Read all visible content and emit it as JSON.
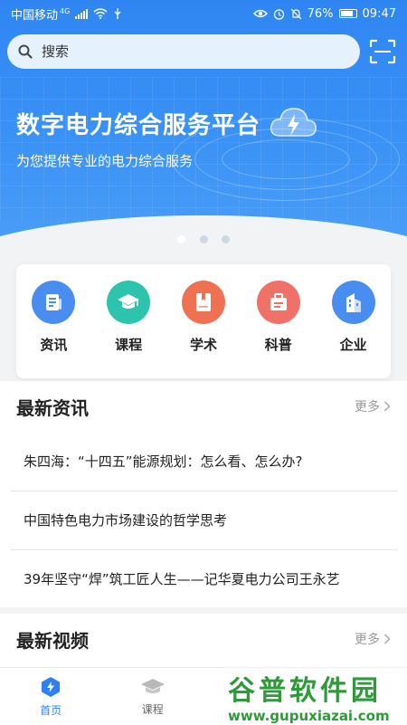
{
  "status_bar": {
    "carrier": "中国移动",
    "network": "4G",
    "battery": "76%",
    "time": "09:47"
  },
  "search": {
    "placeholder": "搜索"
  },
  "banner": {
    "title": "数字电力综合服务平台",
    "subtitle": "为您提供专业的电力综合服务",
    "page_count": 3,
    "active_page": 1
  },
  "menu": [
    {
      "label": "资讯",
      "icon": "news-icon",
      "color": "#4a8df0"
    },
    {
      "label": "课程",
      "icon": "graduation-cap-icon",
      "color": "#2cc4ad"
    },
    {
      "label": "学术",
      "icon": "book-icon",
      "color": "#f07152"
    },
    {
      "label": "科普",
      "icon": "briefcase-icon",
      "color": "#f07168"
    },
    {
      "label": "企业",
      "icon": "building-icon",
      "color": "#4a8df0"
    }
  ],
  "news_section": {
    "title": "最新资讯",
    "more": "更多",
    "items": [
      "朱四海：“十四五”能源规划：怎么看、怎么办?",
      "中国特色电力市场建设的哲学思考",
      "39年坚守“焊”筑工匠人生——记华夏电力公司王永艺"
    ]
  },
  "video_section": {
    "title": "最新视频",
    "more": "更多"
  },
  "tabs": [
    {
      "label": "首页",
      "icon": "home-bolt-icon",
      "active": true
    },
    {
      "label": "课程",
      "icon": "graduation-cap-icon",
      "active": false
    }
  ],
  "watermark": {
    "text": "谷普软件园",
    "url": "www.gupuxiazai.com"
  },
  "colors": {
    "primary": "#2f86f2",
    "active_tab": "#2f7ff0"
  }
}
